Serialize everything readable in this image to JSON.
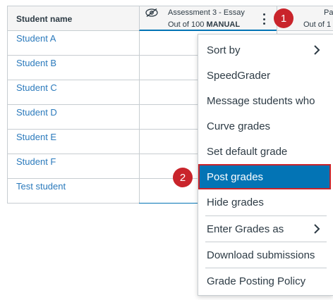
{
  "grid": {
    "name_header": "Student name",
    "assignment": {
      "title": "Assessment 3 - Essay",
      "points_prefix": "Out of 100",
      "posting": "MANUAL"
    },
    "next_column": {
      "title": "Padle",
      "points": "Out of 1"
    },
    "students": [
      "Student A",
      "Student B",
      "Student C",
      "Student D",
      "Student E",
      "Student F",
      "Test student"
    ]
  },
  "menu": {
    "items": [
      {
        "label": "Sort by",
        "submenu": true
      },
      {
        "label": "SpeedGrader"
      },
      {
        "label": "Message students who"
      },
      {
        "label": "Curve grades"
      },
      {
        "label": "Set default grade"
      },
      {
        "label": "Post grades",
        "active": true
      },
      {
        "label": "Hide grades"
      },
      {
        "label": "Enter Grades as",
        "submenu": true
      },
      {
        "label": "Download submissions"
      },
      {
        "label": "Grade Posting Policy"
      }
    ]
  },
  "badges": [
    "1",
    "2"
  ],
  "icons": {
    "hidden": "eye-slash-icon",
    "options": "kebab-menu-icon",
    "submenu": "chevron-right-icon"
  },
  "colors": {
    "link": "#2b7abc",
    "active_bg": "#0374b5",
    "callout": "#c9242b"
  }
}
